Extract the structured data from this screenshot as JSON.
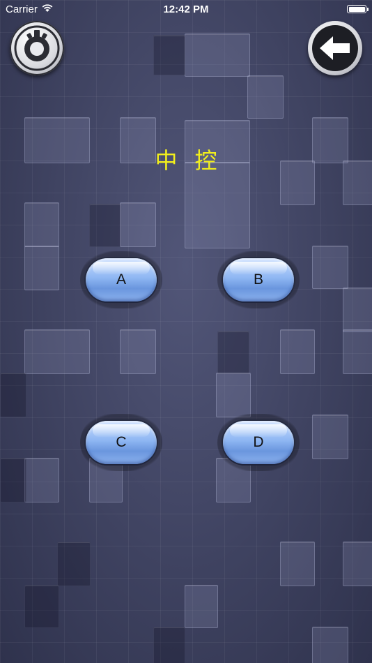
{
  "status_bar": {
    "carrier": "Carrier",
    "time": "12:42 PM",
    "wifi_icon": "wifi-icon",
    "battery_icon": "battery-icon"
  },
  "header": {
    "settings_icon": "settings-icon",
    "back_icon": "back-arrow-icon"
  },
  "title": "中 控",
  "buttons": {
    "a": "A",
    "b": "B",
    "c": "C",
    "d": "D"
  },
  "colors": {
    "title": "#f2ef1c",
    "button_fill": "#8fb7f3",
    "background": "#3d4160"
  }
}
